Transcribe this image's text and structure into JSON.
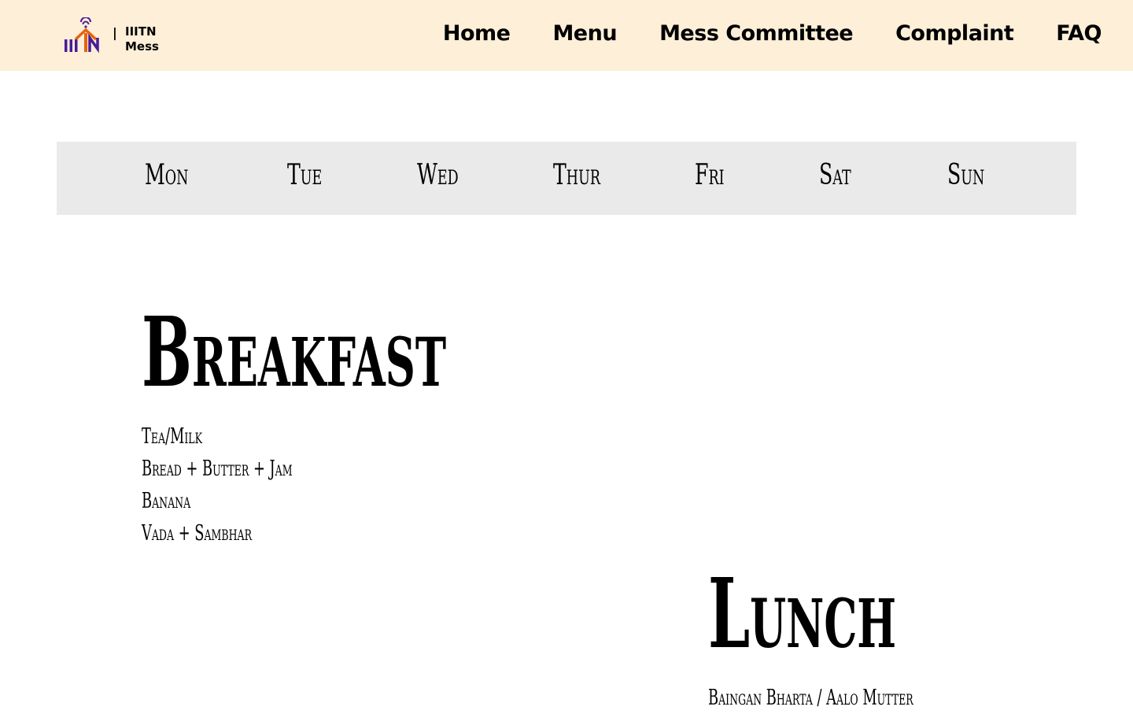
{
  "header": {
    "logo_separator": "|",
    "brand_line1": "IIITN",
    "brand_line2": "Mess",
    "nav": [
      "Home",
      "Menu",
      "Mess Committee",
      "Complaint",
      "FAQ"
    ]
  },
  "days": [
    "Mon",
    "Tue",
    "Wed",
    "Thur",
    "Fri",
    "Sat",
    "Sun"
  ],
  "meals": {
    "breakfast": {
      "title": "Breakfast",
      "items": [
        "Tea/Milk",
        "Bread + Butter + Jam",
        "Banana",
        "Vada + Sambhar"
      ]
    },
    "lunch": {
      "title": "Lunch",
      "items": [
        "Baingan Bharta / Aalo Mutter"
      ]
    }
  },
  "colors": {
    "navbar_bg": "#fdefd8",
    "tabs_bg": "#eaeaea",
    "logo_purple": "#4a1d96",
    "logo_orange": "#e8620c"
  }
}
